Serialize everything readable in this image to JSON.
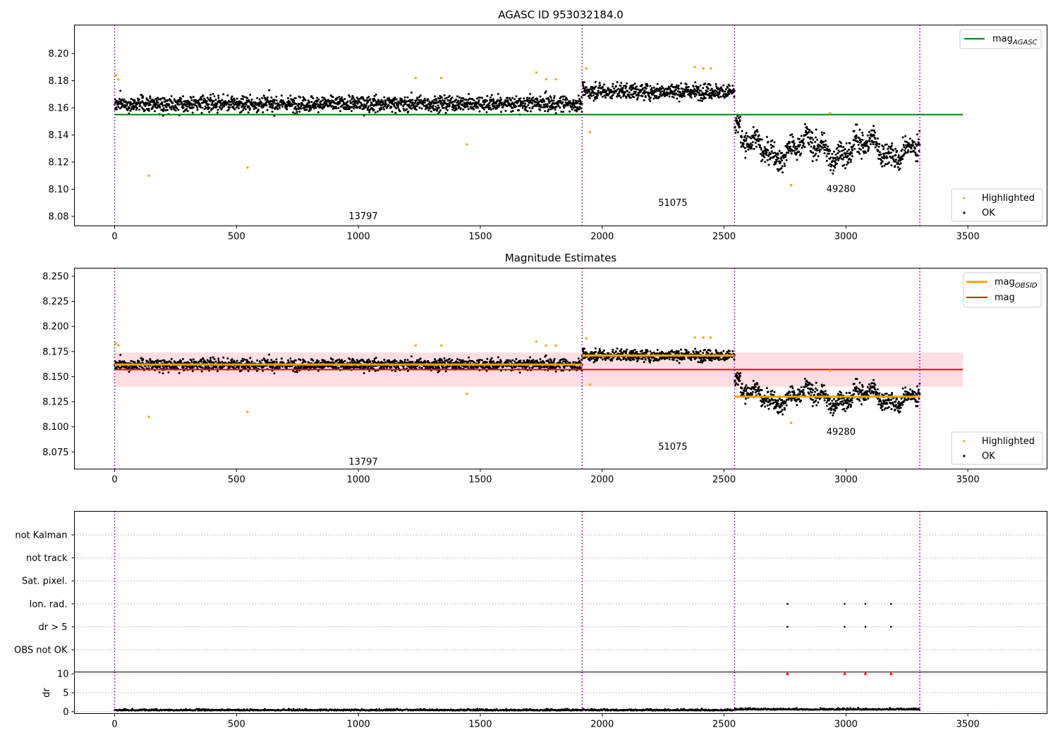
{
  "chart_data": [
    {
      "type": "scatter",
      "title": "AGASC ID 953032184.0",
      "xlim": [
        -165,
        3825
      ],
      "ylim": [
        8.073,
        8.221
      ],
      "xticks": [
        "0",
        "500",
        "1000",
        "1500",
        "2000",
        "2500",
        "3000",
        "3500"
      ],
      "yticks": [
        "8.08",
        "8.10",
        "8.12",
        "8.14",
        "8.16",
        "8.18",
        "8.20"
      ],
      "obs_boundaries": [
        0,
        1918,
        2543,
        3303
      ],
      "obs_labels": [
        {
          "text": "13797",
          "x": 960,
          "y": 8.08
        },
        {
          "text": "51075",
          "x": 2230,
          "y": 8.09
        },
        {
          "text": "49280",
          "x": 2920,
          "y": 8.1
        }
      ],
      "segments": [
        {
          "start": 0,
          "end": 1918,
          "level": 8.163,
          "amp": 0.005
        },
        {
          "start": 1918,
          "end": 2543,
          "level": 8.172,
          "amp": 0.005
        },
        {
          "start": 2543,
          "end": 3303,
          "level": 8.13,
          "amp": 0.008
        }
      ],
      "lines": [
        {
          "name": "mag_AGASC",
          "color": "#008000",
          "y": 8.155,
          "x0": 0,
          "x1": 3480
        }
      ],
      "highlighted": [
        [
          5,
          8.184
        ],
        [
          15,
          8.181
        ],
        [
          140,
          8.11
        ],
        [
          545,
          8.116
        ],
        [
          1235,
          8.182
        ],
        [
          1340,
          8.182
        ],
        [
          1445,
          8.133
        ],
        [
          1730,
          8.186
        ],
        [
          1770,
          8.181
        ],
        [
          1810,
          8.181
        ],
        [
          1935,
          8.189
        ],
        [
          1950,
          8.142
        ],
        [
          2380,
          8.19
        ],
        [
          2415,
          8.189
        ],
        [
          2445,
          8.189
        ],
        [
          2775,
          8.103
        ],
        [
          2935,
          8.156
        ]
      ],
      "legend_top": {
        "placement": "upper right",
        "items": [
          {
            "label": "mag",
            "sub": "AGASC",
            "color": "#008000"
          }
        ]
      },
      "legend_bottom": {
        "placement": "lower right",
        "items": [
          {
            "label": "Highlighted",
            "color": "#ffa500"
          },
          {
            "label": "OK",
            "color": "#000000"
          }
        ]
      }
    },
    {
      "type": "scatter",
      "title": "Magnitude Estimates",
      "xlim": [
        -165,
        3825
      ],
      "ylim": [
        8.058,
        8.258
      ],
      "xticks": [
        "0",
        "500",
        "1000",
        "1500",
        "2000",
        "2500",
        "3000",
        "3500"
      ],
      "yticks": [
        "8.075",
        "8.100",
        "8.125",
        "8.150",
        "8.175",
        "8.200",
        "8.225",
        "8.250"
      ],
      "obs_boundaries": [
        0,
        1918,
        2543,
        3303
      ],
      "obs_labels": [
        {
          "text": "13797",
          "x": 960,
          "y": 8.065
        },
        {
          "text": "51075",
          "x": 2230,
          "y": 8.08
        },
        {
          "text": "49280",
          "x": 2920,
          "y": 8.095
        }
      ],
      "segments": [
        {
          "start": 0,
          "end": 1918,
          "level": 8.162,
          "amp": 0.005
        },
        {
          "start": 1918,
          "end": 2543,
          "level": 8.171,
          "amp": 0.005
        },
        {
          "start": 2543,
          "end": 3303,
          "level": 8.13,
          "amp": 0.008
        }
      ],
      "band": {
        "y0": 8.14,
        "y1": 8.174,
        "x0": 0,
        "x1": 3480,
        "color": "#ffb6c1"
      },
      "lines": [
        {
          "name": "mag",
          "color": "#ff0000",
          "y": 8.157,
          "x0": 0,
          "x1": 3480
        }
      ],
      "obsid_mags": [
        {
          "x0": 0,
          "x1": 1918,
          "y": 8.162
        },
        {
          "x0": 1918,
          "x1": 2543,
          "y": 8.171
        },
        {
          "x0": 2543,
          "x1": 3303,
          "y": 8.13
        }
      ],
      "highlighted": [
        [
          5,
          8.183
        ],
        [
          15,
          8.181
        ],
        [
          140,
          8.11
        ],
        [
          545,
          8.115
        ],
        [
          1235,
          8.181
        ],
        [
          1340,
          8.181
        ],
        [
          1445,
          8.133
        ],
        [
          1730,
          8.185
        ],
        [
          1770,
          8.181
        ],
        [
          1810,
          8.181
        ],
        [
          1935,
          8.188
        ],
        [
          1950,
          8.142
        ],
        [
          2380,
          8.189
        ],
        [
          2415,
          8.189
        ],
        [
          2445,
          8.189
        ],
        [
          2775,
          8.104
        ],
        [
          2935,
          8.156
        ]
      ],
      "legend_top": {
        "placement": "upper right",
        "items": [
          {
            "label": "mag",
            "sub": "OBSID",
            "color": "#ffa500"
          },
          {
            "label": "mag",
            "sub": "",
            "color": "#ff0000"
          }
        ]
      },
      "legend_bottom": {
        "placement": "lower right",
        "items": [
          {
            "label": "Highlighted",
            "color": "#ffa500"
          },
          {
            "label": "OK",
            "color": "#000000"
          }
        ]
      }
    },
    {
      "type": "scatter",
      "xlim": [
        -165,
        3825
      ],
      "flag_rows": [
        "not Kalman",
        "not track",
        "Sat. pixel.",
        "Ion. rad.",
        "dr > 5",
        "OBS not OK"
      ],
      "flag_points": [
        {
          "row": "Ion. rad.",
          "x": [
            2760,
            2995,
            3080,
            3185
          ]
        },
        {
          "row": "dr > 5",
          "x": [
            2760,
            2995,
            3080,
            3185
          ]
        }
      ],
      "obs_boundaries": [
        0,
        1918,
        2543,
        3303
      ]
    },
    {
      "type": "scatter",
      "ylabel": "dr",
      "xlim": [
        -165,
        3825
      ],
      "ylim": [
        -0.5,
        10.5
      ],
      "xticks": [
        "0",
        "500",
        "1000",
        "1500",
        "2000",
        "2500",
        "3000",
        "3500"
      ],
      "yticks": [
        "0",
        "5",
        "10"
      ],
      "clipped_points": [
        2760,
        2995,
        3080,
        3185
      ],
      "obs_boundaries": [
        0,
        1918,
        2543,
        3303
      ]
    }
  ],
  "colors": {
    "ok": "#000000",
    "highlighted": "#ffa500",
    "boundary": "#800080",
    "clipped": "#ff0000"
  }
}
